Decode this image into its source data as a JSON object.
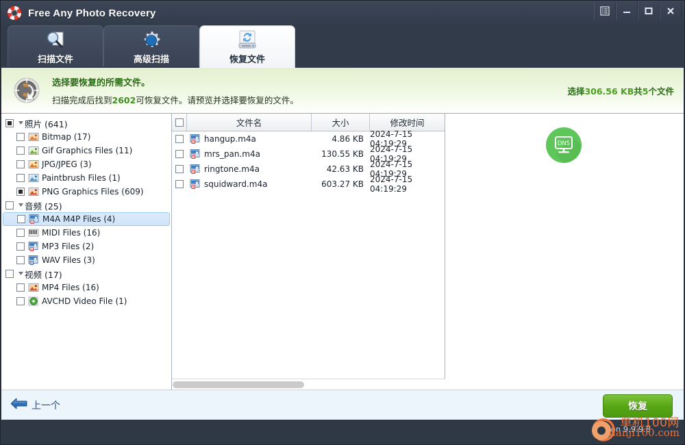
{
  "window": {
    "title": "Free Any Photo Recovery",
    "logo_icon": "lifebuoy-icon",
    "controls": [
      {
        "name": "menu-button",
        "icon": "list-menu-icon"
      },
      {
        "name": "minimize-button",
        "icon": "minimize-icon"
      },
      {
        "name": "maximize-button",
        "icon": "maximize-icon"
      },
      {
        "name": "close-button",
        "icon": "close-icon"
      }
    ]
  },
  "tabs": [
    {
      "label": "扫描文件",
      "icon": "magnifier-document-icon",
      "active": false
    },
    {
      "label": "高级扫描",
      "icon": "gear-icon",
      "active": false
    },
    {
      "label": "恢复文件",
      "icon": "recover-drive-icon",
      "active": true
    }
  ],
  "banner": {
    "icon": "recovery-circle-icon",
    "heading": "选择要恢复的所需文件。",
    "subtext_pre": "扫描完成后找到",
    "subtext_count": "2602",
    "subtext_post": "可恢复文件。请预览并选择要恢复的文件。",
    "selection_pre": "选择",
    "selection_size": "306.56 KB",
    "selection_mid": "共",
    "selection_count": "5",
    "selection_post": "个文件"
  },
  "sidebar": {
    "groups": [
      {
        "label": "照片 (641)",
        "checkbox": "partial",
        "expanded": true,
        "children": [
          {
            "label": "Bitmap (17)",
            "checkbox": "empty",
            "icon": "bitmap-file-icon",
            "selected": false
          },
          {
            "label": "Gif Graphics Files (11)",
            "checkbox": "empty",
            "icon": "gif-file-icon",
            "selected": false
          },
          {
            "label": "JPG/JPEG (3)",
            "checkbox": "empty",
            "icon": "jpg-file-icon",
            "selected": false
          },
          {
            "label": "Paintbrush Files (1)",
            "checkbox": "empty",
            "icon": "paintbrush-file-icon",
            "selected": false
          },
          {
            "label": "PNG Graphics Files (609)",
            "checkbox": "partial",
            "icon": "png-file-icon",
            "selected": false
          }
        ]
      },
      {
        "label": "音频 (25)",
        "checkbox": "empty",
        "expanded": true,
        "children": [
          {
            "label": "M4A M4P Files (4)",
            "checkbox": "empty",
            "icon": "m4a-file-icon",
            "selected": true
          },
          {
            "label": "MIDI Files (16)",
            "checkbox": "empty",
            "icon": "midi-file-icon",
            "selected": false
          },
          {
            "label": "MP3 Files (2)",
            "checkbox": "empty",
            "icon": "mp3-file-icon",
            "selected": false
          },
          {
            "label": "WAV Files (3)",
            "checkbox": "empty",
            "icon": "wav-file-icon",
            "selected": false
          }
        ]
      },
      {
        "label": "视频 (17)",
        "checkbox": "empty",
        "expanded": true,
        "children": [
          {
            "label": "MP4 Files (16)",
            "checkbox": "empty",
            "icon": "mp4-file-icon",
            "selected": false
          },
          {
            "label": "AVCHD Video File (1)",
            "checkbox": "empty",
            "icon": "avchd-file-icon",
            "selected": false
          }
        ]
      }
    ]
  },
  "filetable": {
    "headers": [
      "",
      "文件名",
      "大小",
      "修改时间"
    ],
    "rows": [
      {
        "name": "hangup.m4a",
        "size": "4.86 KB",
        "modified": "2024-7-15 04:19:29",
        "icon": "m4a-file-icon",
        "checked": false
      },
      {
        "name": "mrs_pan.m4a",
        "size": "130.55 KB",
        "modified": "2024-7-15 04:19:29",
        "icon": "m4a-file-icon",
        "checked": false
      },
      {
        "name": "ringtone.m4a",
        "size": "42.63 KB",
        "modified": "2024-7-15 04:19:29",
        "icon": "m4a-file-icon",
        "checked": false
      },
      {
        "name": "squidward.m4a",
        "size": "603.27 KB",
        "modified": "2024-7-15 04:19:29",
        "icon": "m4a-file-icon",
        "checked": false
      }
    ]
  },
  "preview": {
    "badge_label": "DNS",
    "badge_icon": "dns-monitor-icon"
  },
  "footer": {
    "back_label": "上一个",
    "back_icon": "back-arrow-icon",
    "recover_label": "恢复"
  },
  "statusbar": {
    "version": "sion 9.9.9.8",
    "watermark_line1": "单机100网",
    "watermark_line2": "danji100.com",
    "watermark_icon": "camera-shutter-icon"
  },
  "colors": {
    "accent_green": "#57a616",
    "titlebar": "#3c4657",
    "banner_green": "#e4f0d0",
    "selection_blue": "#cfe4fa",
    "watermark_orange": "#e8743c"
  }
}
